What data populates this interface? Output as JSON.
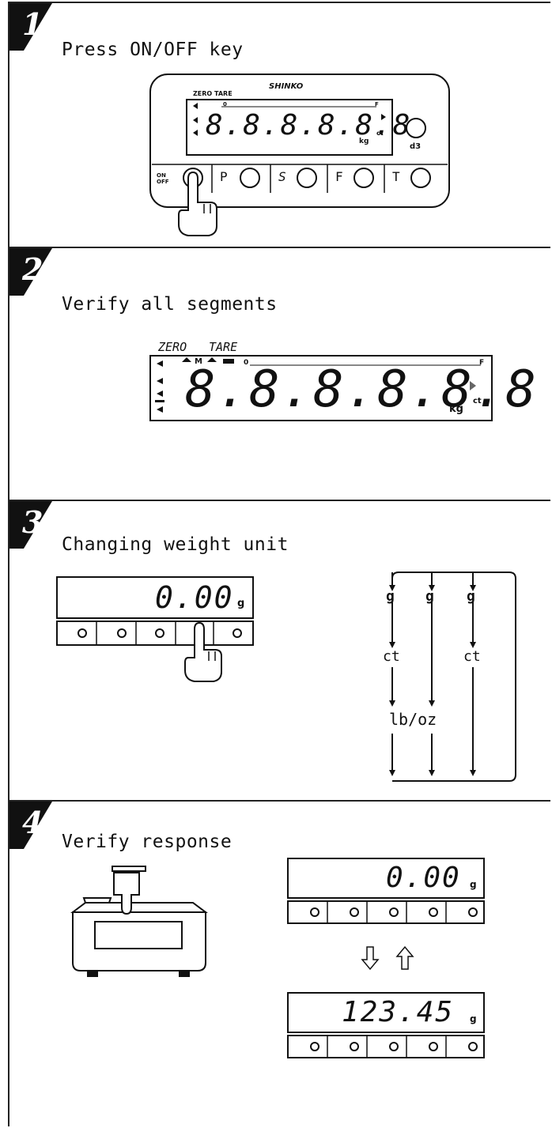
{
  "steps": [
    {
      "number": "1",
      "title": "Press ON/OFF key",
      "panel": {
        "brand": "SHINKO",
        "top_labels": "ZERO TARE",
        "digits": "8.8.8.8.8.8",
        "unit": "kg",
        "bar_label": "0",
        "bar_end": "F",
        "side_unit": "ct",
        "knob_label": "d3",
        "keys": [
          {
            "label": "ON OFF",
            "name": "on-off"
          },
          {
            "label": "P",
            "name": "p"
          },
          {
            "label": "S",
            "name": "s"
          },
          {
            "label": "F",
            "name": "f"
          },
          {
            "label": "T",
            "name": "t"
          }
        ]
      }
    },
    {
      "number": "2",
      "title": "Verify all segments",
      "display": {
        "label_left": "ZERO",
        "label_right": "TARE",
        "indicators": "M",
        "bar_start": "0",
        "bar_end": "F",
        "digits": "8.8.8.8.8.8",
        "unit": "kg",
        "side_unit": "ct"
      }
    },
    {
      "number": "3",
      "title": "Changing weight unit",
      "display": {
        "digits": "0.00",
        "unit": "g"
      },
      "flow": {
        "columns": [
          "g",
          "g",
          "g"
        ],
        "middle_left": "ct",
        "middle_right": "ct",
        "bottom": "lb/oz"
      }
    },
    {
      "number": "4",
      "title": "Verify response",
      "display_top": {
        "digits": "0.00",
        "unit": "g"
      },
      "display_bottom": {
        "digits": "123.45",
        "unit": "g"
      }
    }
  ],
  "colors": {
    "ink": "#111111",
    "paper": "#ffffff",
    "gray": "#9a9a9a"
  }
}
